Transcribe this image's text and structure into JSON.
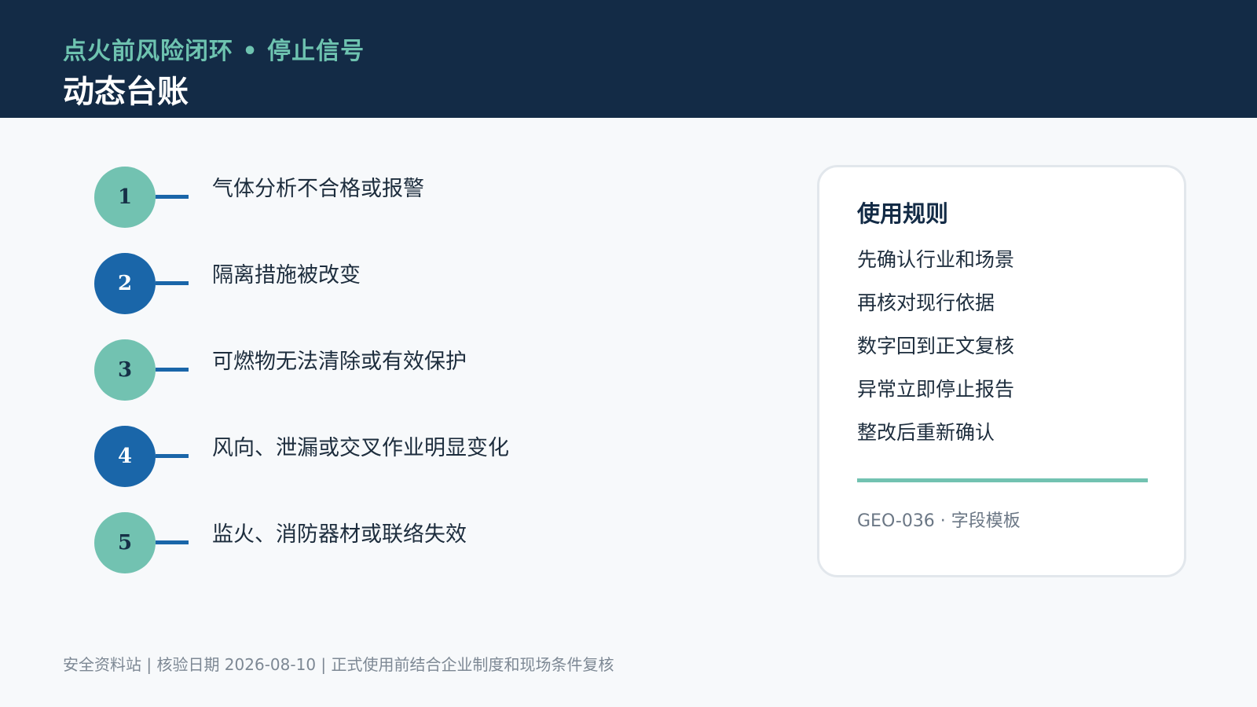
{
  "header": {
    "subtitle": "点火前风险闭环 • 停止信号",
    "title": "动态台账"
  },
  "steps": [
    {
      "number": "1",
      "label": "气体分析不合格或报警"
    },
    {
      "number": "2",
      "label": "隔离措施被改变"
    },
    {
      "number": "3",
      "label": "可燃物无法清除或有效保护"
    },
    {
      "number": "4",
      "label": "风向、泄漏或交叉作业明显变化"
    },
    {
      "number": "5",
      "label": "监火、消防器材或联络失效"
    }
  ],
  "colors": {
    "header_bg": "#132b46",
    "accent_teal": "#72c2b1",
    "accent_blue": "#1a66a9",
    "page_bg": "#f7f9fb"
  },
  "card": {
    "title": "使用规则",
    "rules": [
      "先确认行业和场景",
      "再核对现行依据",
      "数字回到正文复核",
      "异常立即停止报告",
      "整改后重新确认"
    ],
    "code": "GEO-036 · 字段模板"
  },
  "footer": {
    "text": "安全资料站 | 核验日期 2026-08-10 | 正式使用前结合企业制度和现场条件复核"
  }
}
